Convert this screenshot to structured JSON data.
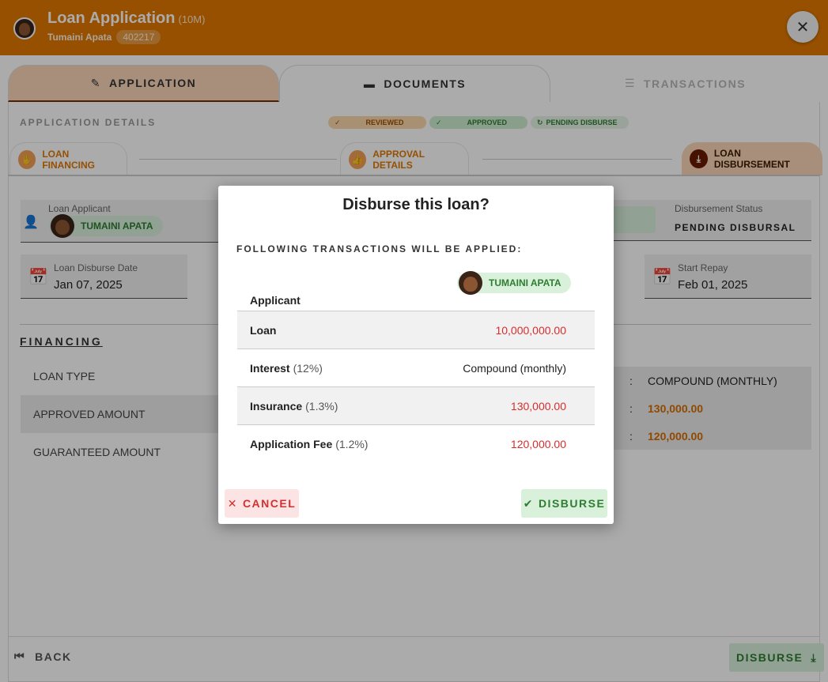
{
  "header": {
    "title": "Loan Application",
    "title_suffix": "(10M)",
    "applicant_name": "Tumaini Apata",
    "applicant_id": "402217",
    "close_icon": "close-icon"
  },
  "tabs": [
    {
      "label": "APPLICATION",
      "icon": "user-pen-icon",
      "state": "active"
    },
    {
      "label": "DOCUMENTS",
      "icon": "folder-icon",
      "state": "normal"
    },
    {
      "label": "TRANSACTIONS",
      "icon": "ledger-icon",
      "state": "disabled"
    }
  ],
  "application_details": {
    "title": "APPLICATION DETAILS",
    "status_chips": [
      {
        "label": "REVIEWED",
        "icon": "check-icon"
      },
      {
        "label": "APPROVED",
        "icon": "check-icon"
      },
      {
        "label": "PENDING DISBURSE",
        "icon": "pending-icon"
      }
    ]
  },
  "steps": [
    {
      "label": "LOAN FINANCING",
      "icon": "hand-coin-icon"
    },
    {
      "label": "APPROVAL DETAILS",
      "icon": "thumbs-up-icon"
    },
    {
      "label": "LOAN DISBURSEMENT",
      "icon": "download-icon"
    }
  ],
  "fields": {
    "applicant_label": "Loan Applicant",
    "applicant_value": "TUMAINI APATA",
    "disbursement_status_label": "Disbursement Status",
    "disbursement_status_value": "PENDING DISBURSAL",
    "disburse_date_label": "Loan Disburse Date",
    "disburse_date_value": "Jan 07, 2025",
    "start_repay_label": "Start Repay",
    "start_repay_value": "Feb 01, 2025"
  },
  "financing": {
    "title": "FINANCING",
    "rows": [
      {
        "label": "LOAN TYPE",
        "colon": ":",
        "value": "COMPOUND (MONTHLY)"
      },
      {
        "label": "APPROVED AMOUNT",
        "colon": ":",
        "value": "130,000.00"
      },
      {
        "label": "GUARANTEED AMOUNT",
        "colon": ":",
        "value": "120,000.00"
      }
    ]
  },
  "footer": {
    "back_label": "BACK",
    "disburse_label": "DISBURSE"
  },
  "modal": {
    "title": "Disburse this loan?",
    "subtitle": "FOLLOWING TRANSACTIONS WILL BE APPLIED:",
    "applicant_label": "Applicant",
    "applicant_value": "TUMAINI APATA",
    "rows": [
      {
        "label": "Loan",
        "pct": "",
        "value": "10,000,000.00"
      },
      {
        "label": "Interest",
        "pct": "(12%)",
        "value": "Compound (monthly)"
      },
      {
        "label": "Insurance",
        "pct": "(1.3%)",
        "value": "130,000.00"
      },
      {
        "label": "Application Fee",
        "pct": "(1.2%)",
        "value": "120,000.00"
      }
    ],
    "cancel_label": "CANCEL",
    "disburse_label": "DISBURSE"
  },
  "colors": {
    "header": "#e07800",
    "accent_green": "#2e7d32",
    "amount_red": "#d82d2d",
    "amount_orange": "#d76d00"
  }
}
